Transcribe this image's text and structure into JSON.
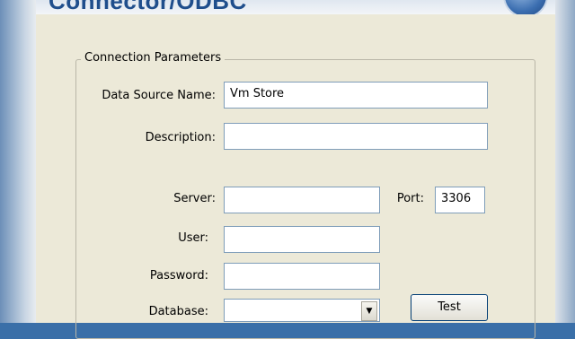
{
  "banner": {
    "title": "Connector/ODBC"
  },
  "group": {
    "title": "Connection Parameters"
  },
  "fields": {
    "dsn": {
      "label": "Data Source Name:",
      "value": "Vm Store"
    },
    "description": {
      "label": "Description:",
      "value": ""
    },
    "server": {
      "label": "Server:",
      "value": ""
    },
    "port": {
      "label": "Port:",
      "value": "3306"
    },
    "user": {
      "label": "User:",
      "value": ""
    },
    "password": {
      "label": "Password:",
      "value": ""
    },
    "database": {
      "label": "Database:",
      "value": ""
    }
  },
  "buttons": {
    "test": "Test"
  },
  "icons": {
    "dropdown": "chevron-down-icon",
    "logo": "mysql-logo-icon"
  }
}
